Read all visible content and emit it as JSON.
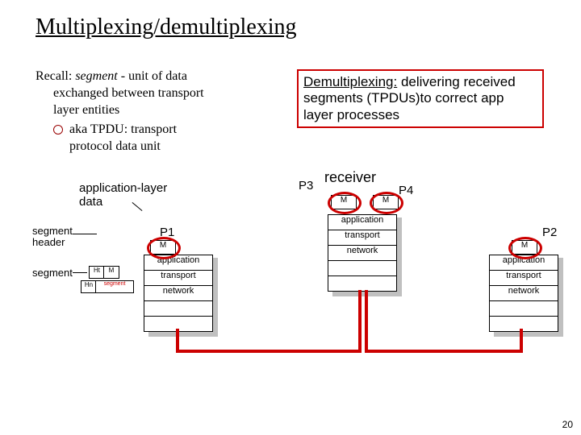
{
  "title": "Multiplexing/demultiplexing",
  "recall": {
    "prefix": "Recall: ",
    "segment_word": "segment",
    "rest1": " - unit of data",
    "line2": "exchanged between transport",
    "line3": "layer entities",
    "bullet1": "aka TPDU: transport",
    "bullet2": "protocol data unit"
  },
  "demux": {
    "head": "Demultiplexing:",
    "rest": " delivering received segments (TPDUs)to correct app layer processes"
  },
  "labels": {
    "receiver": "receiver",
    "app_layer_data1": "application-layer",
    "app_layer_data2": "data",
    "segment_header1": "segment",
    "segment_header2": "header",
    "segment": "segment"
  },
  "process": {
    "P1": "P1",
    "P2": "P2",
    "P3": "P3",
    "P4": "P4",
    "M": "M"
  },
  "stack_labels": {
    "app": "application",
    "trans": "transport",
    "net": "network"
  },
  "tiny": {
    "Ht": "Ht",
    "Hn": "Hn",
    "M": "M",
    "segment": "segment"
  },
  "page": "20"
}
